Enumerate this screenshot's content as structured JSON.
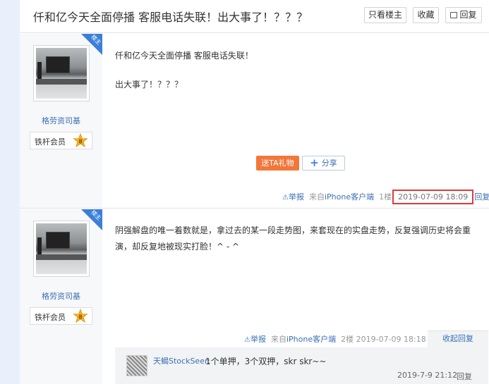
{
  "header": {
    "title": "仟和亿今天全面停播 客服电话失联！出大事了！？？？",
    "only_author": "只看楼主",
    "favorite": "收藏",
    "reply": "回复"
  },
  "posts": [
    {
      "badge": "楼主",
      "author": "格劳资司基",
      "member_level": "铁杆会员",
      "level_number": "8",
      "lines": [
        "仟和亿今天全面停播 客服电话失联！",
        "出大事了！？？？"
      ],
      "gift_label": "送TA礼物",
      "share_label": "分享",
      "report": "举报",
      "source": "来自",
      "device": "iPhone客户端",
      "floor": "1楼",
      "datetime": "2019-07-09 18:09",
      "reply": "回复"
    },
    {
      "badge": "楼主",
      "author": "格劳资司基",
      "member_level": "铁杆会员",
      "level_number": "8",
      "text": "阴强解盘的唯一着数就是，拿过去的某一段走势图，来套现在的实盘走势，反复强调历史将会重演，却反复地被现实打脸！^ - ^",
      "report": "举报",
      "source": "来自",
      "device": "iPhone客户端",
      "floor": "2楼",
      "datetime": "2019-07-09 18:18",
      "fold_reply": "收起回复",
      "sub_reply": {
        "user": "天蝎StockSeer:",
        "text": "1个单押，3个双押，skr skr~~",
        "datetime": "2019-7-9 21:12",
        "reply": "回复"
      }
    }
  ],
  "colors": {
    "highlight_box": "#e03a3a",
    "link_blue": "#3b6fb6",
    "gift_orange": "#f2773a",
    "badge_blue": "#3b7fd9",
    "level_gold": "#f0b429"
  }
}
